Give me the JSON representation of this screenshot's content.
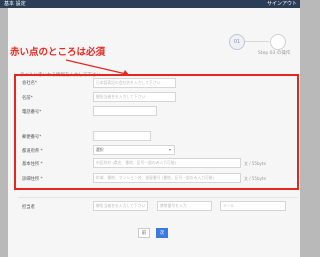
{
  "header": {
    "title": "基本 設定",
    "action": "サインアウト"
  },
  "steps": {
    "step1_number": "01",
    "step2_label": "Step 03 の操作"
  },
  "annotation": {
    "callout": "赤い点のところは必須",
    "color": "#e5281f"
  },
  "form": {
    "hint": "ラベルに赤いれる情報を入力して下さい",
    "company_label": "会社名*",
    "company_placeholder": "日本語表記の会社名を入力して下さい",
    "name_label": "名前*",
    "name_placeholder": "御担当者名を入力して下さい",
    "phone_label": "電話番号*",
    "postal_label": "郵便番号*",
    "prefecture_label": "都道府県 *",
    "prefecture_value": "選択",
    "address1_label": "基本住所 *",
    "address1_placeholder": "市区町村 (県名、番地、区号一部のみ入力可能)",
    "address1_suffix": "文 / 55byte",
    "address2_label": "詳細住所 *",
    "address2_placeholder": "町域、番地、マンション名、部屋番号 (番地、区号一部のみ入力可能)",
    "address2_suffix": "文 / 55byte",
    "contact_label": "担当者",
    "contact_placeholder_1": "御担当者名を入力して下さい",
    "contact_placeholder_2": "携帯番号を入力",
    "contact_placeholder_3": "メール"
  },
  "buttons": {
    "back": "前",
    "next": "次"
  }
}
